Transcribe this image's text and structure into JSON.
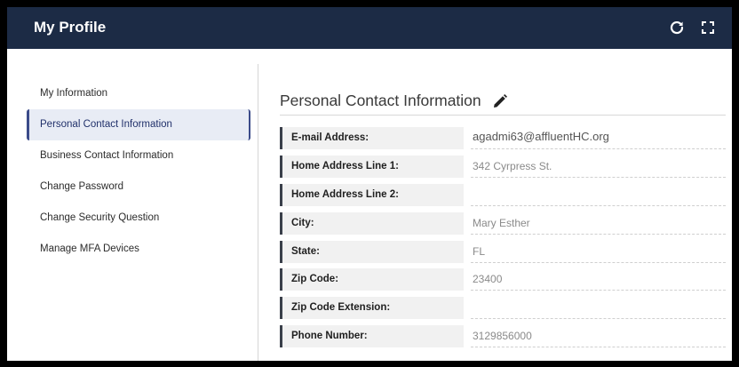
{
  "header": {
    "title": "My Profile",
    "refresh_icon": "refresh-icon",
    "fullscreen_icon": "fullscreen-icon"
  },
  "sidebar": {
    "items": [
      {
        "label": "My Information",
        "active": false
      },
      {
        "label": "Personal Contact Information",
        "active": true
      },
      {
        "label": "Business Contact Information",
        "active": false
      },
      {
        "label": "Change Password",
        "active": false
      },
      {
        "label": "Change Security Question",
        "active": false
      },
      {
        "label": "Manage MFA Devices",
        "active": false
      }
    ]
  },
  "main": {
    "section_title": "Personal Contact Information",
    "edit_icon": "pencil-icon",
    "fields": [
      {
        "label": "E-mail Address:",
        "value": "agadmi63@affluentHC.org"
      },
      {
        "label": "Home Address Line 1:",
        "value": "342 Cyrpress St."
      },
      {
        "label": "Home Address Line 2:",
        "value": ""
      },
      {
        "label": "City:",
        "value": "Mary Esther"
      },
      {
        "label": "State:",
        "value": "FL"
      },
      {
        "label": "Zip Code:",
        "value": "23400"
      },
      {
        "label": "Zip Code Extension:",
        "value": ""
      },
      {
        "label": "Phone Number:",
        "value": "3129856000"
      }
    ]
  },
  "colors": {
    "header_bg": "#1c2b45",
    "active_accent": "#3b4b8a",
    "label_bar": "#3a3f4a"
  }
}
